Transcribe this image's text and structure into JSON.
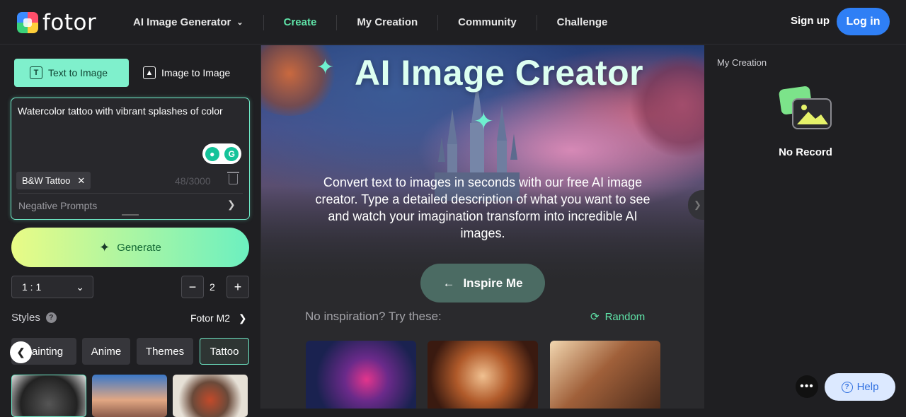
{
  "brand": {
    "name": "fotor"
  },
  "nav": {
    "items": [
      {
        "label": "AI Image Generator",
        "active": false,
        "dropdown": true
      },
      {
        "label": "Create",
        "active": true
      },
      {
        "label": "My Creation",
        "active": false
      },
      {
        "label": "Community",
        "active": false
      },
      {
        "label": "Challenge",
        "active": false
      }
    ],
    "signup": "Sign up",
    "login": "Log in"
  },
  "left": {
    "tabs": [
      {
        "label": "Text to Image",
        "icon": "text-box-icon",
        "active": true
      },
      {
        "label": "Image to Image",
        "icon": "image-icon",
        "active": false
      }
    ],
    "prompt": {
      "value": "Watercolor tattoo with vibrant splashes of color",
      "style_tag": "B&W Tattoo",
      "counter": "48/3000",
      "negative_label": "Negative Prompts"
    },
    "generate_label": "Generate",
    "ratio": "1 : 1",
    "count": "2",
    "styles_label": "Styles",
    "model": "Fotor M2",
    "style_chips": [
      "Painting",
      "Anime",
      "Themes",
      "Tattoo"
    ],
    "selected_chip": "Tattoo"
  },
  "hero": {
    "title": "AI Image Creator",
    "description": "Convert text to images in seconds with our free AI image creator. Type a detailed description of what you want to see and watch your imagination transform into incredible AI images.",
    "inspire_label": "Inspire Me",
    "try_label": "No inspiration? Try these:",
    "random_label": "Random"
  },
  "right": {
    "title": "My Creation",
    "empty_label": "No Record"
  },
  "help": {
    "label": "Help"
  },
  "colors": {
    "accent": "#5fe3a8",
    "login_blue": "#2f7ff5",
    "background": "#1f1f22"
  }
}
